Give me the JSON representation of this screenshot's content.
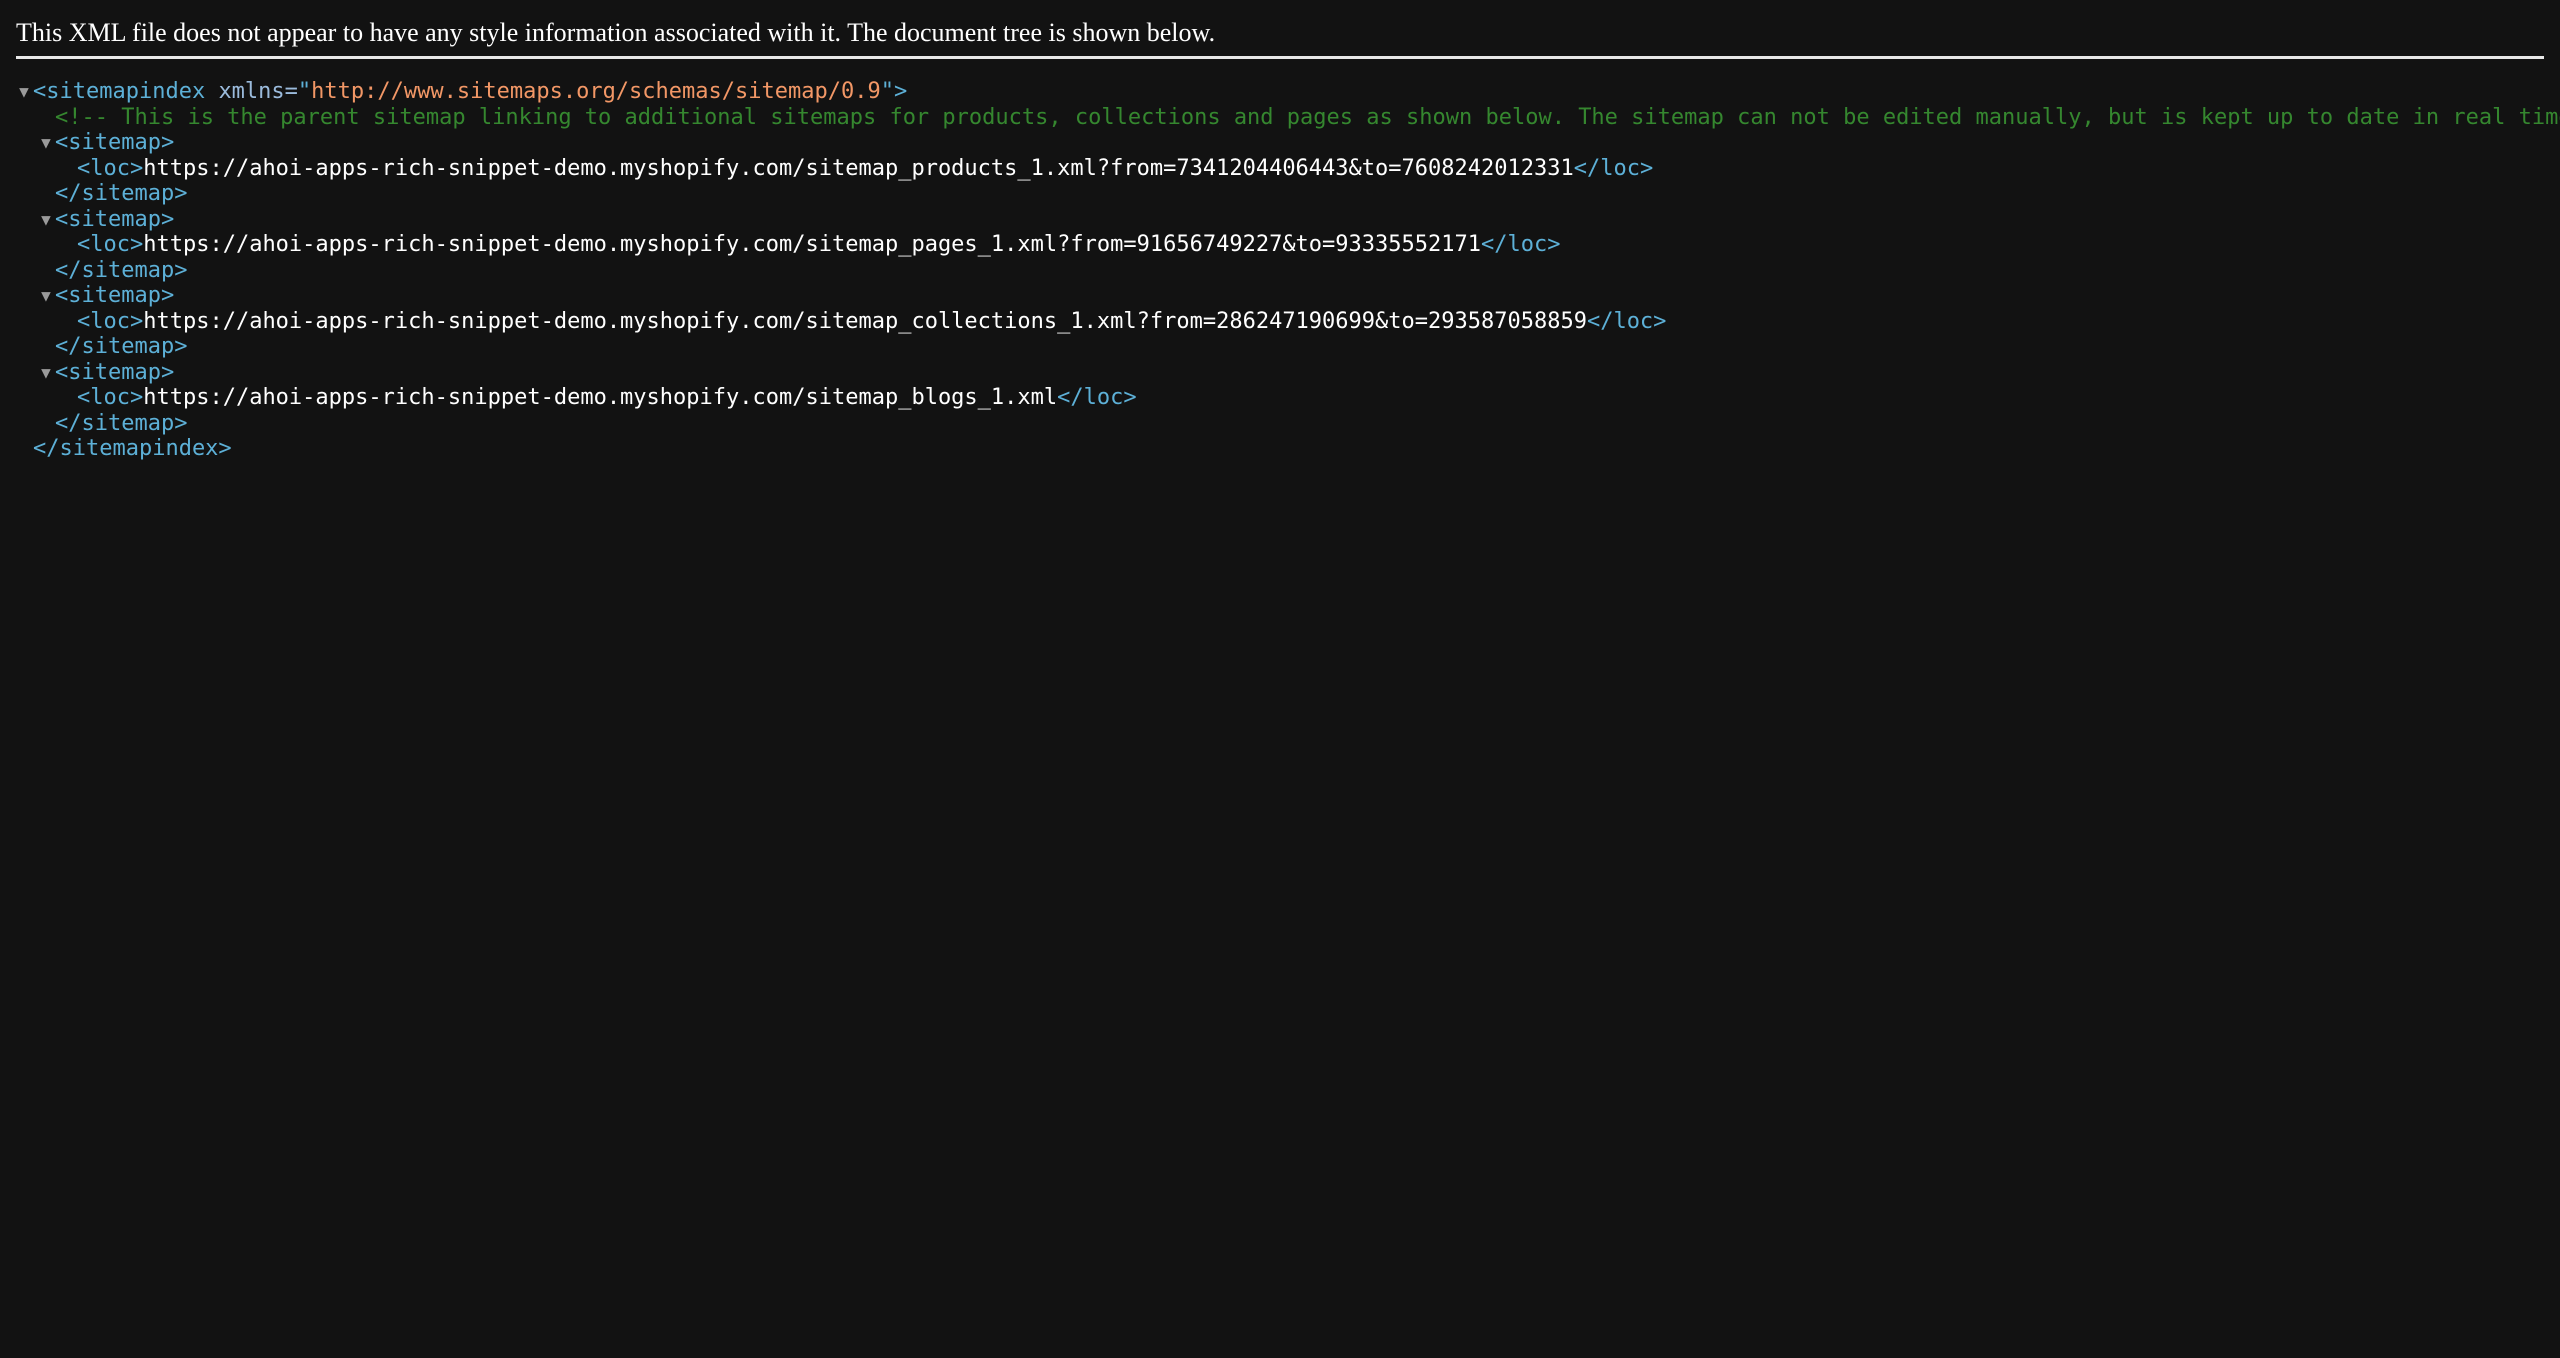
{
  "header": {
    "message": "This XML file does not appear to have any style information associated with it. The document tree is shown below."
  },
  "colors": {
    "background": "#121212",
    "tag": "#5db0d7",
    "attribute_value": "#f29766",
    "text": "#ffffff",
    "comment": "#35872f"
  },
  "tree": {
    "root_open_tag": "<sitemapindex",
    "root_attr_name": "xmlns=",
    "root_attr_quote_open": "\"",
    "root_attr_value": "http://www.sitemaps.org/schemas/sitemap/0.9",
    "root_attr_quote_close": "\">",
    "comment": "<!--  This is the parent sitemap linking to additional sitemaps for products, collections and pages as shown below. The sitemap can not be edited manually, but is kept up to date in real time",
    "sitemap_open": "<sitemap>",
    "sitemap_close": "</sitemap>",
    "loc_open": "<loc>",
    "loc_close": "</loc>",
    "root_close_tag": "</sitemapindex>",
    "twisty": "▼",
    "locs": [
      "https://ahoi-apps-rich-snippet-demo.myshopify.com/sitemap_products_1.xml?from=7341204406443&to=7608242012331",
      "https://ahoi-apps-rich-snippet-demo.myshopify.com/sitemap_pages_1.xml?from=91656749227&to=93335552171",
      "https://ahoi-apps-rich-snippet-demo.myshopify.com/sitemap_collections_1.xml?from=286247190699&to=293587058859",
      "https://ahoi-apps-rich-snippet-demo.myshopify.com/sitemap_blogs_1.xml"
    ]
  }
}
